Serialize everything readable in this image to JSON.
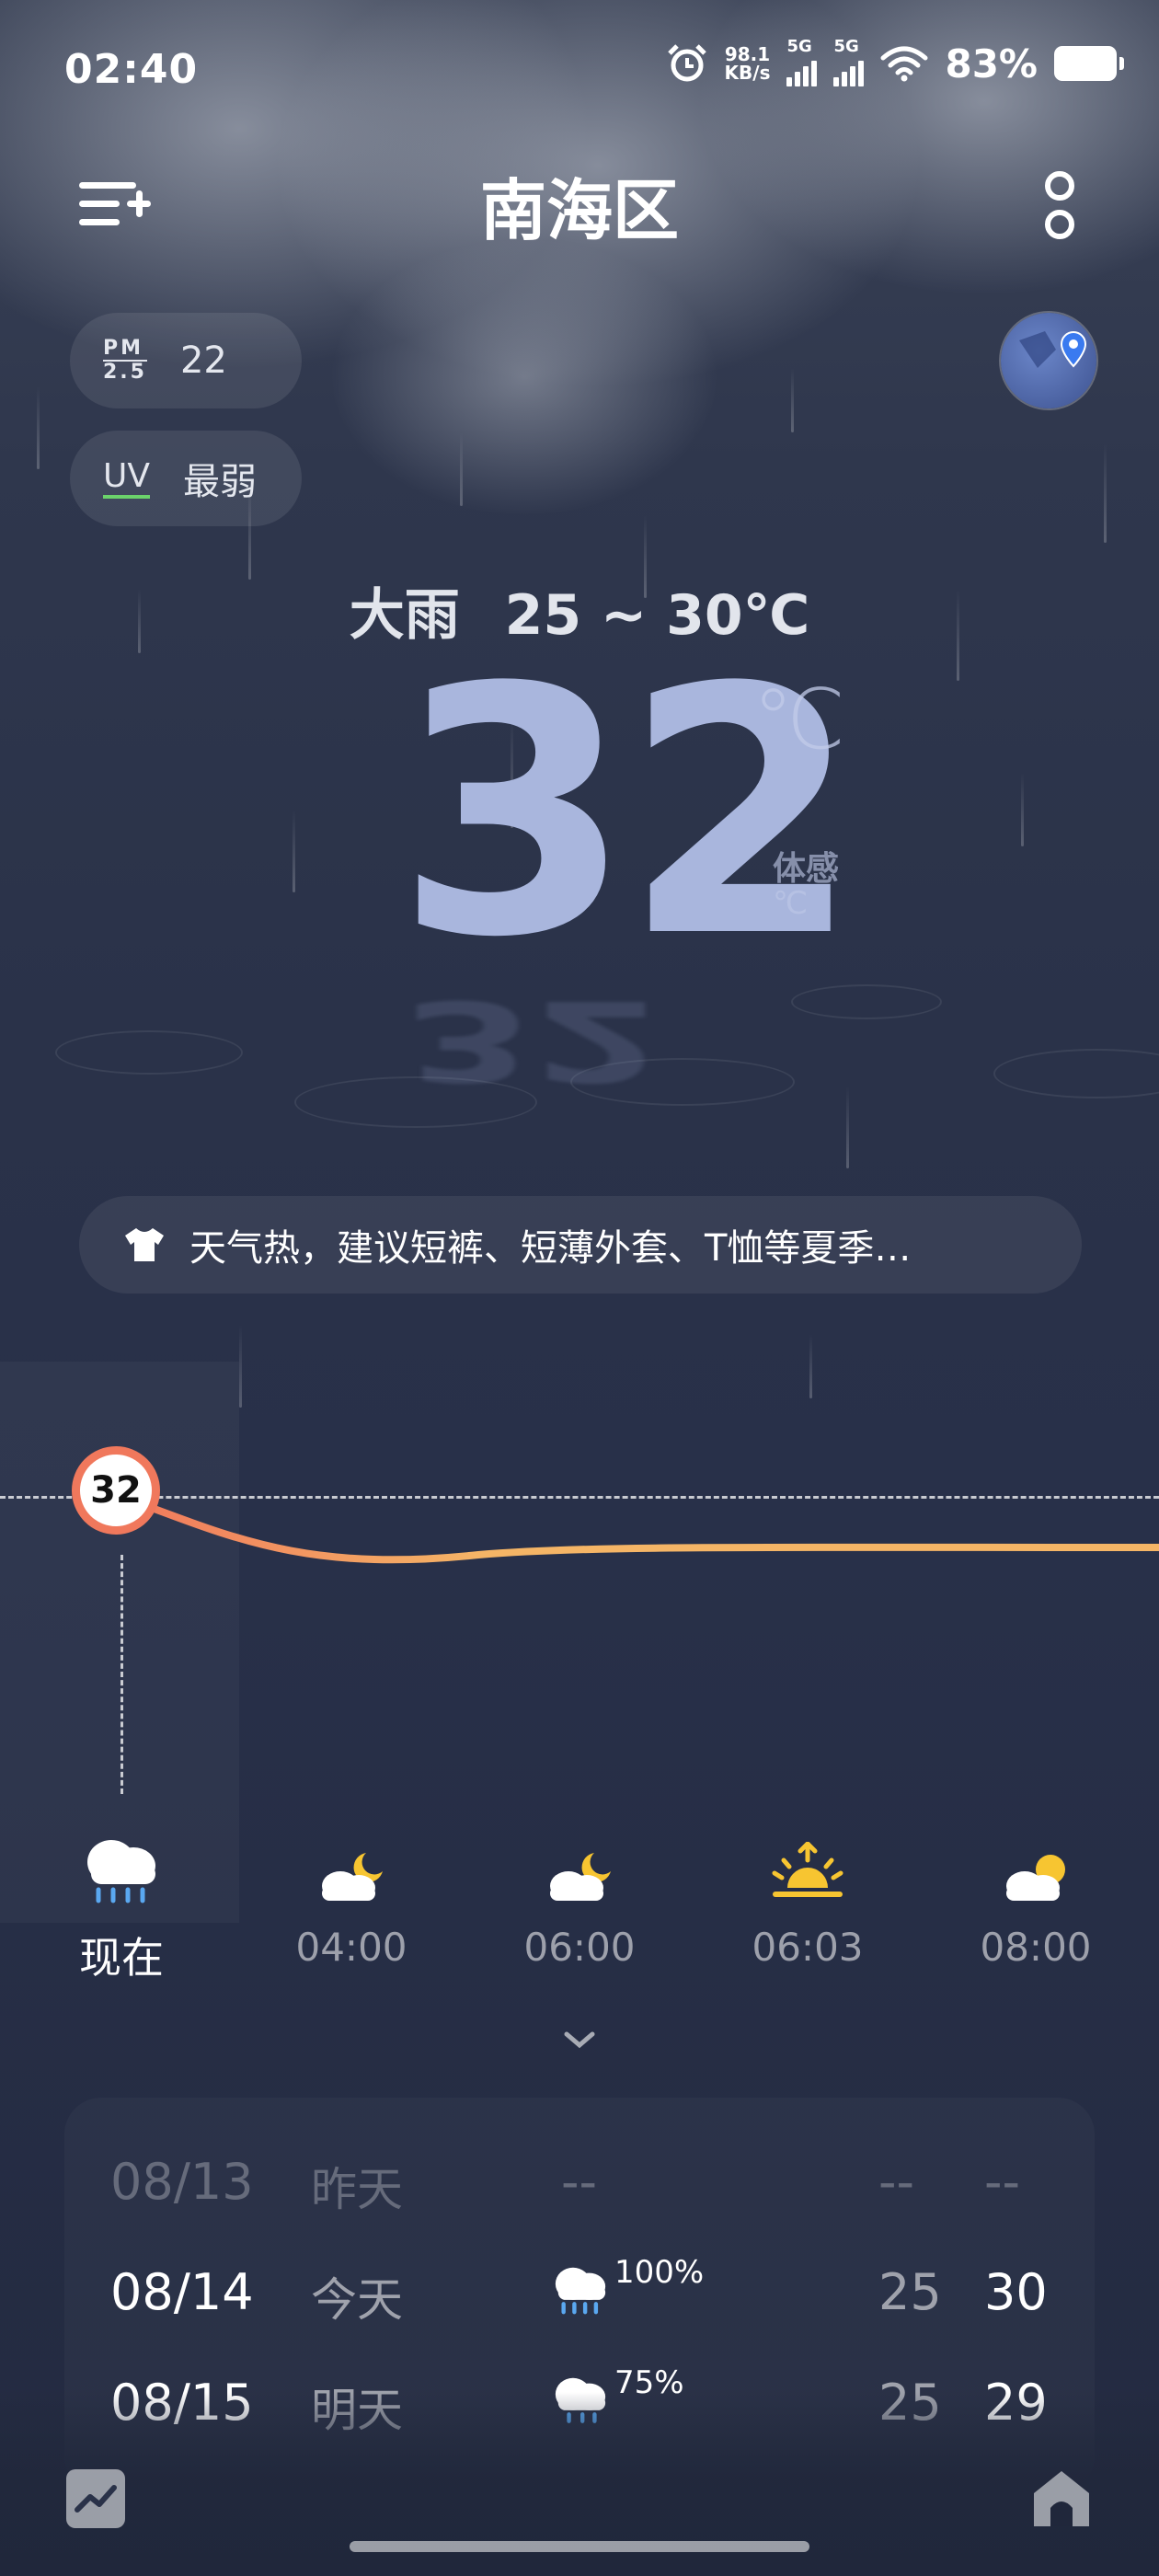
{
  "status_bar": {
    "time": "02:40",
    "net_speed_value": "98.1",
    "net_speed_unit": "KB/s",
    "signal1_label": "5G",
    "signal2_label": "5G",
    "battery_percent": "83%",
    "battery_level": 0.83
  },
  "header": {
    "city": "南海区"
  },
  "air": {
    "pm_label_top": "PM",
    "pm_label_bottom": "2.5",
    "pm_value": "22",
    "uv_label": "UV",
    "uv_value": "最弱"
  },
  "current": {
    "condition": "大雨",
    "range": "25 ~ 30℃",
    "temperature": "32",
    "unit": "℃",
    "feels_label": "体感",
    "feels_unit": "℃"
  },
  "advice": {
    "icon": "shirt-icon",
    "text": "天气热，建议短裤、短薄外套、T恤等夏季…"
  },
  "hourly": {
    "now_temp": "32",
    "items": [
      {
        "label": "现在",
        "icon": "heavy-rain-icon"
      },
      {
        "label": "04:00",
        "icon": "cloudy-night-icon"
      },
      {
        "label": "06:00",
        "icon": "cloudy-night-icon"
      },
      {
        "label": "06:03",
        "icon": "sunrise-icon"
      },
      {
        "label": "08:00",
        "icon": "cloudy-day-icon"
      }
    ]
  },
  "daily": [
    {
      "date": "08/13",
      "day": "昨天",
      "weather": "--",
      "low": "--",
      "high": "--"
    },
    {
      "date": "08/14",
      "day": "今天",
      "icon": "heavy-rain-icon",
      "pop": "100%",
      "low": "25",
      "high": "30"
    },
    {
      "date": "08/15",
      "day": "明天",
      "icon": "rain-icon",
      "pop": "75%",
      "low": "25",
      "high": "29"
    }
  ],
  "colors": {
    "curve_start": "#f0785c",
    "curve_end": "#f5b566",
    "sun": "#f7c531",
    "rain_drop": "#5aa8f0",
    "uv_underline": "#6bd36b"
  }
}
